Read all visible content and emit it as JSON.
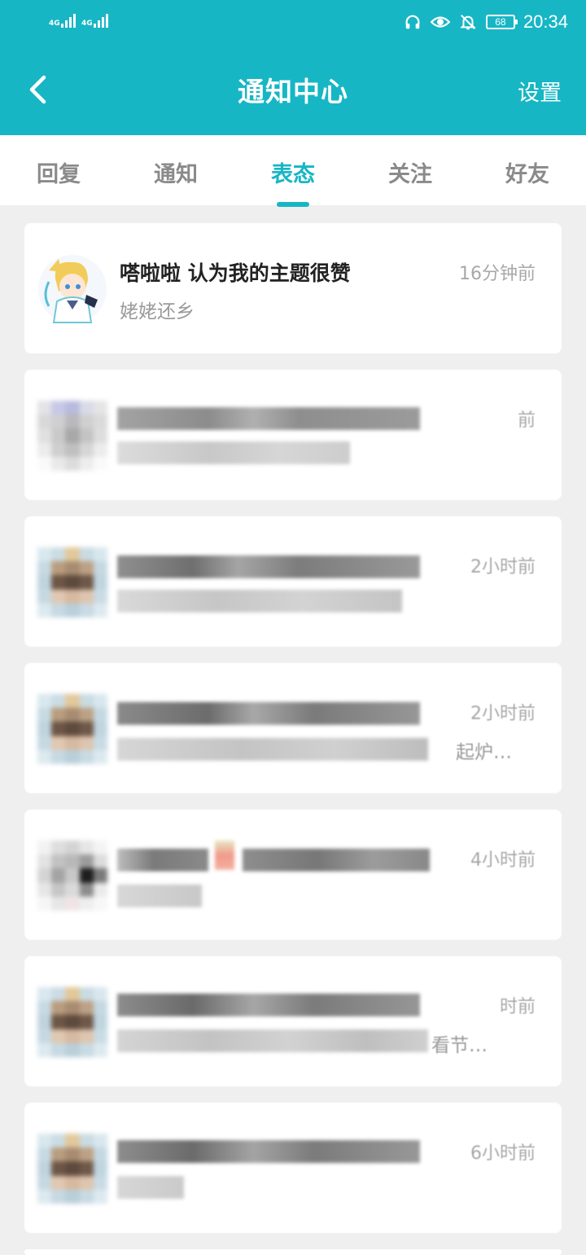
{
  "status_bar": {
    "sim1": "4G",
    "sim2": "4G",
    "battery": "68",
    "time": "20:34",
    "icons": [
      "headphones-icon",
      "eye-icon",
      "bell-off-icon"
    ]
  },
  "nav": {
    "back_icon": "chevron-left-icon",
    "title": "通知中心",
    "settings_label": "设置"
  },
  "tabs": [
    {
      "label": "回复",
      "active": false
    },
    {
      "label": "通知",
      "active": false
    },
    {
      "label": "表态",
      "active": true
    },
    {
      "label": "关注",
      "active": false
    },
    {
      "label": "好友",
      "active": false
    }
  ],
  "notifications": [
    {
      "title": "嗒啦啦 认为我的主题很赞",
      "subtitle": "姥姥还乡",
      "time": "16分钟前",
      "blurred": false
    },
    {
      "title": "",
      "subtitle": "",
      "time": "前",
      "blurred": true
    },
    {
      "title": "",
      "subtitle": "",
      "time": "2小时前",
      "blurred": true
    },
    {
      "title": "",
      "subtitle": "起炉…",
      "time": "2小时前",
      "blurred": true
    },
    {
      "title": "",
      "subtitle": "",
      "time": "4小时前",
      "blurred": true
    },
    {
      "title": "",
      "subtitle": "看节…",
      "time": "时前",
      "blurred": true
    },
    {
      "title": "",
      "subtitle": "",
      "time": "6小时前",
      "blurred": true
    }
  ],
  "colors": {
    "accent": "#17b6c5",
    "background": "#efefef",
    "card": "#ffffff"
  }
}
